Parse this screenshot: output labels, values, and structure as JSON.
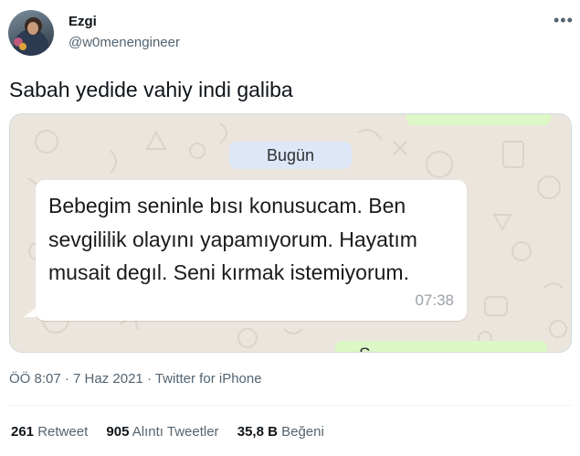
{
  "author": {
    "name": "Ezgi",
    "handle": "@w0menengineer"
  },
  "more_glyph": "•••",
  "tweet_text": "Sabah yedide vahiy indi galiba",
  "media": {
    "date_chip": "Bugün",
    "message_text": "Bebegim seninle bısı konusucam. Ben sevgililik olayını yapamıyorum. Hayatım musait degıl. Seni kırmak istemiyorum.",
    "message_time": "07:38",
    "partial_bottom_text": "S"
  },
  "meta": {
    "time": "ÖÖ 8:07",
    "sep1": " · ",
    "date": "7 Haz 2021",
    "sep2": " · ",
    "source": "Twitter for iPhone"
  },
  "stats": {
    "retweets_count": "261",
    "retweets_label": "Retweet",
    "quotes_count": "905",
    "quotes_label": "Alıntı Tweetler",
    "likes_count": "35,8 B",
    "likes_label": "Beğeni"
  },
  "colors": {
    "chat_background": "#ece5dd",
    "incoming_bubble": "#ffffff",
    "outgoing_bubble": "#dcf8c6",
    "date_chip": "#dde7f7",
    "secondary_text": "#536471"
  }
}
